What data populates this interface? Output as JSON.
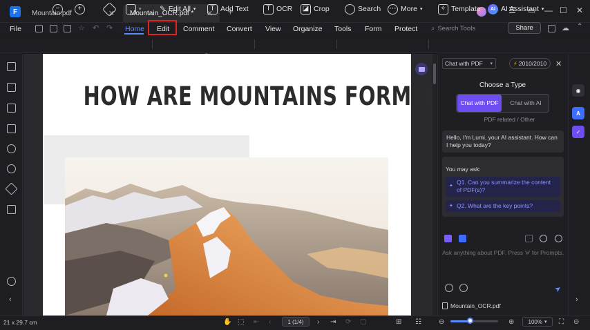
{
  "tabs": [
    {
      "label": "Mountain.pdf",
      "active": false
    },
    {
      "label": "Mountain_OCR.pdf *",
      "active": true
    }
  ],
  "menu": {
    "file": "File",
    "items": [
      "Home",
      "Edit",
      "Comment",
      "Convert",
      "View",
      "Organize",
      "Tools",
      "Form",
      "Protect"
    ],
    "active": "Home",
    "highlighted": "Edit",
    "search_placeholder": "Search Tools",
    "share": "Share"
  },
  "toolbar": {
    "edit_all": "Edit All",
    "add_text": "Add Text",
    "ocr": "OCR",
    "crop": "Crop",
    "search": "Search",
    "more": "More",
    "template": "Template",
    "ai_assistant": "AI Assistant"
  },
  "document": {
    "title": "HOW ARE MOUNTAINS FORMED?"
  },
  "ai_panel": {
    "mode_select": "Chat with PDF",
    "credits": "2010/2010",
    "choose_type_title": "Choose a Type",
    "option_pdf": "Chat with PDF",
    "option_ai": "Chat with AI",
    "subtitle": "PDF related / Other",
    "greeting": "Hello, I'm Lumi, your AI assistant. How can I help you today?",
    "you_may_ask": "You may ask:",
    "questions": [
      "Q1. Can you summarize the content of PDF(s)?",
      "Q2. What are the key points?"
    ],
    "input_placeholder": "Ask anything about PDF. Press '#' for Prompts.",
    "file_name": "Mountain_OCR.pdf"
  },
  "status": {
    "page_size": "21 x 29.7 cm",
    "page_indicator": "1 (1/4)",
    "zoom": "100%",
    "zoom_level": 0.4
  },
  "colors": {
    "accent": "#5f8dff",
    "highlight_box": "#e02424",
    "ai_purple": "#6e4df2"
  }
}
